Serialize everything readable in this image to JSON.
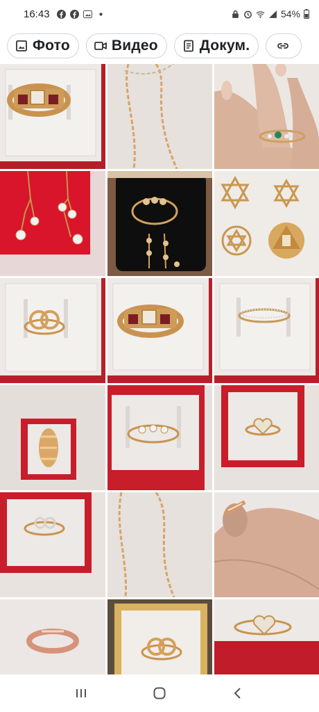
{
  "status_bar": {
    "time": "16:43",
    "battery": "54%",
    "left_icons": [
      "facebook-icon",
      "facebook-icon",
      "photo-icon",
      "dot-icon"
    ],
    "right_icons": [
      "lock-icon",
      "alarm-icon",
      "wifi-icon",
      "signal-icon",
      "battery-icon"
    ]
  },
  "filters": [
    {
      "label": "Фото",
      "icon": "image-icon"
    },
    {
      "label": "Видео",
      "icon": "video-icon"
    },
    {
      "label": "Докум.",
      "icon": "document-icon"
    },
    {
      "label": "",
      "icon": "link-icon"
    }
  ],
  "photos": [
    {
      "subject": "ring-square-stone-red-box"
    },
    {
      "subject": "gold-chain"
    },
    {
      "subject": "ring-emerald-on-finger"
    },
    {
      "subject": "earrings-crystal-balls-red-box"
    },
    {
      "subject": "jewelry-set-bracelet-earrings"
    },
    {
      "subject": "star-of-david-pendants"
    },
    {
      "subject": "ring-interlocked-cc"
    },
    {
      "subject": "ring-square-stone-red-box"
    },
    {
      "subject": "ring-thin-band"
    },
    {
      "subject": "ring-gold-shield"
    },
    {
      "subject": "ring-bow-crystals"
    },
    {
      "subject": "ring-heart"
    },
    {
      "subject": "ring-crystal-knot"
    },
    {
      "subject": "gold-chain"
    },
    {
      "subject": "ring-leaf-on-finger"
    },
    {
      "subject": "ring-rose-gold-band"
    },
    {
      "subject": "ring-interlocked-cc-gold-box"
    },
    {
      "subject": "ring-heart-on-red"
    }
  ],
  "colors": {
    "box_red": "#c4202b",
    "cushion": "#ece9e6",
    "gold": "#d9a45c",
    "chip_border": "#cfd4da"
  },
  "navigation": [
    "recent-apps-icon",
    "home-icon",
    "back-icon"
  ]
}
